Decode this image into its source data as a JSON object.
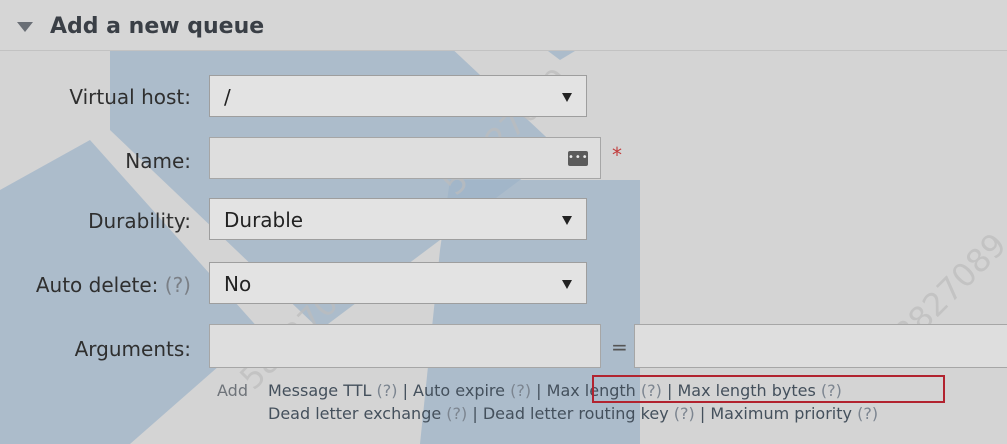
{
  "section": {
    "title": "Add a new queue"
  },
  "form": {
    "virtual_host": {
      "label": "Virtual host:",
      "value": "/"
    },
    "name": {
      "label": "Name:",
      "value": "",
      "required_marker": "*"
    },
    "durability": {
      "label": "Durability:",
      "value": "Durable"
    },
    "auto_delete": {
      "label": "Auto delete:",
      "help": "(?)",
      "value": "No"
    },
    "arguments": {
      "label": "Arguments:",
      "equals": "="
    }
  },
  "args_links": {
    "add_label": "Add",
    "message_ttl": "Message TTL",
    "auto_expire": "Auto expire",
    "max_length": "Max length",
    "max_length_bytes": "Max length bytes",
    "dead_letter_exchange": "Dead letter exchange",
    "dead_letter_routing_key": "Dead letter routing key",
    "maximum_priority": "Maximum priority",
    "help": "(?)",
    "separator": "|"
  },
  "watermark": {
    "text": "58827089"
  },
  "icons": {
    "collapse": "triangle-down-icon",
    "password_manager": "more-dots-icon",
    "dropdown": "chevron-down-icon"
  }
}
